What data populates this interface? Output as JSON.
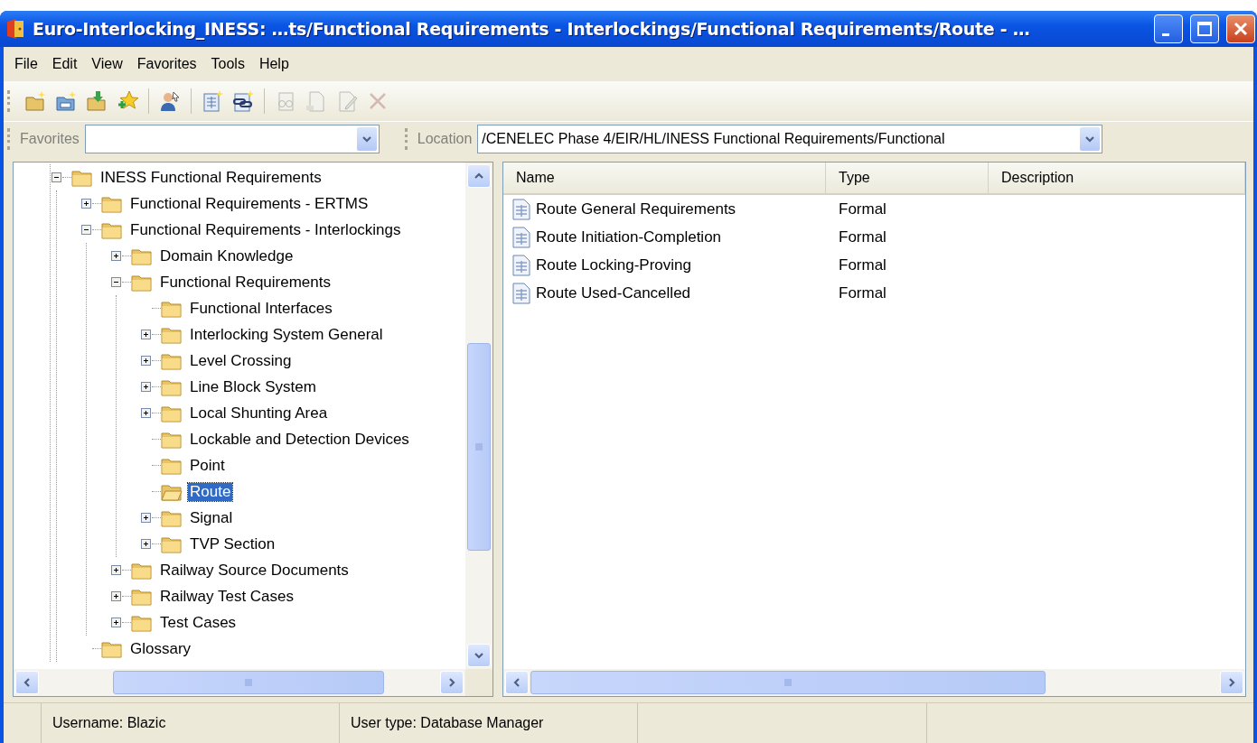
{
  "window": {
    "title": "Euro-Interlocking_INESS: …ts/Functional Requirements - Interlockings/Functional Requirements/Route - …"
  },
  "menu": [
    "File",
    "Edit",
    "View",
    "Favorites",
    "Tools",
    "Help"
  ],
  "toolbar": [
    [
      {
        "kind": "new-folder",
        "disabled": false
      },
      {
        "kind": "new-container",
        "disabled": false
      },
      {
        "kind": "import",
        "disabled": false
      },
      {
        "kind": "add-favorite",
        "disabled": false
      }
    ],
    [
      {
        "kind": "user",
        "disabled": false
      }
    ],
    [
      {
        "kind": "new-document",
        "disabled": false
      },
      {
        "kind": "new-link",
        "disabled": false
      }
    ],
    [
      {
        "kind": "view",
        "disabled": true
      },
      {
        "kind": "document",
        "disabled": true
      },
      {
        "kind": "edit",
        "disabled": true
      },
      {
        "kind": "delete",
        "disabled": true
      }
    ]
  ],
  "favorites": {
    "label": "Favorites"
  },
  "location": {
    "label": "Location",
    "value": "/CENELEC Phase 4/EIR/HL/INESS Functional Requirements/Functional"
  },
  "tree": [
    {
      "label": "INESS Functional Requirements",
      "expanded": true,
      "selected": false,
      "children": [
        {
          "label": "Functional Requirements - ERTMS",
          "expanded": false,
          "selected": false
        },
        {
          "label": "Functional Requirements - Interlockings",
          "expanded": true,
          "selected": false,
          "children": [
            {
              "label": "Domain Knowledge",
              "expanded": false,
              "selected": false
            },
            {
              "label": "Functional Requirements",
              "expanded": true,
              "selected": false,
              "children": [
                {
                  "label": "Functional Interfaces",
                  "selected": false
                },
                {
                  "label": "Interlocking System General",
                  "expanded": false,
                  "selected": false
                },
                {
                  "label": "Level Crossing",
                  "expanded": false,
                  "selected": false
                },
                {
                  "label": "Line Block System",
                  "expanded": false,
                  "selected": false
                },
                {
                  "label": "Local Shunting Area",
                  "expanded": false,
                  "selected": false
                },
                {
                  "label": "Lockable and Detection Devices",
                  "selected": false
                },
                {
                  "label": "Point",
                  "selected": false
                },
                {
                  "label": "Route",
                  "selected": true
                },
                {
                  "label": "Signal",
                  "expanded": false,
                  "selected": false
                },
                {
                  "label": "TVP Section",
                  "expanded": false,
                  "selected": false
                }
              ]
            },
            {
              "label": "Railway Source Documents",
              "expanded": false,
              "selected": false
            },
            {
              "label": "Railway Test Cases",
              "expanded": false,
              "selected": false
            },
            {
              "label": "Test Cases",
              "expanded": false,
              "selected": false
            }
          ]
        },
        {
          "label": "Glossary",
          "selected": false
        }
      ]
    }
  ],
  "table": {
    "columns": [
      "Name",
      "Type",
      "Description"
    ],
    "rows": [
      {
        "name": "Route General Requirements",
        "type": "Formal"
      },
      {
        "name": "Route Initiation-Completion",
        "type": "Formal"
      },
      {
        "name": "Route Locking-Proving",
        "type": "Formal"
      },
      {
        "name": "Route Used-Cancelled",
        "type": "Formal"
      }
    ]
  },
  "status_bar": [
    "Username: Blazic",
    "User type: Database Manager"
  ]
}
